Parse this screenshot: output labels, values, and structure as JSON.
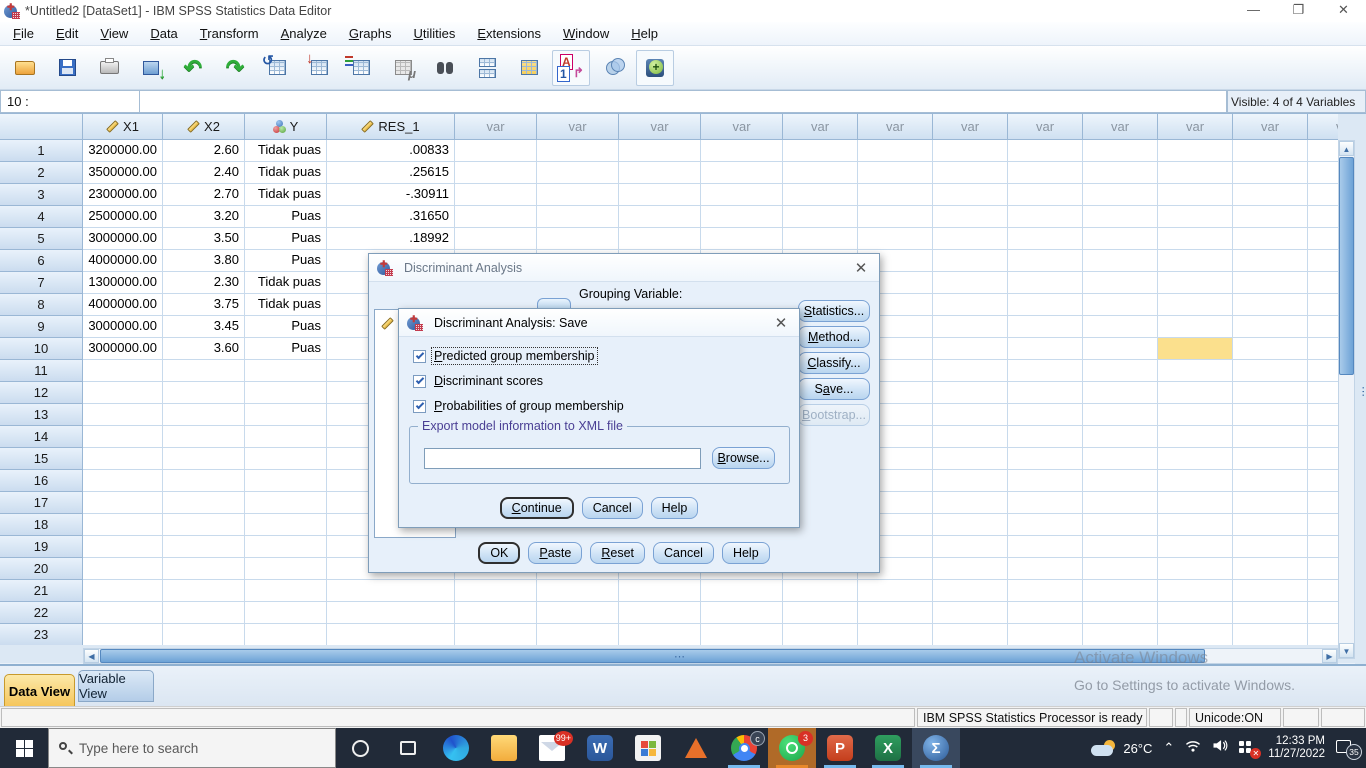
{
  "window": {
    "title": "*Untitled2 [DataSet1] - IBM SPSS Statistics Data Editor"
  },
  "menu": {
    "items": [
      {
        "label": "File",
        "accel": 0
      },
      {
        "label": "Edit",
        "accel": 0
      },
      {
        "label": "View",
        "accel": 0
      },
      {
        "label": "Data",
        "accel": 0
      },
      {
        "label": "Transform",
        "accel": 0
      },
      {
        "label": "Analyze",
        "accel": 0
      },
      {
        "label": "Graphs",
        "accel": 0
      },
      {
        "label": "Utilities",
        "accel": 0
      },
      {
        "label": "Extensions",
        "accel": 0
      },
      {
        "label": "Window",
        "accel": 0
      },
      {
        "label": "Help",
        "accel": 0
      }
    ]
  },
  "toolbar": {
    "icons": [
      "open-data-icon",
      "save-icon",
      "print-icon",
      "recall-dialogs-icon",
      "undo-icon",
      "redo-icon",
      "goto-case-icon",
      "goto-variable-icon",
      "variables-icon",
      "descriptives-icon",
      "find-icon",
      "split-file-icon",
      "select-cases-icon",
      "value-labels-icon",
      "use-variable-sets-icon",
      "extensions-icon"
    ]
  },
  "cellref": {
    "value": "10 :",
    "editor_value": "",
    "visible_indicator": "Visible: 4 of 4 Variables"
  },
  "grid": {
    "columns": [
      {
        "name": "X1",
        "type": "scale"
      },
      {
        "name": "X2",
        "type": "scale"
      },
      {
        "name": "Y",
        "type": "nominal"
      },
      {
        "name": "RES_1",
        "type": "scale"
      }
    ],
    "var_label": "var",
    "rows": [
      {
        "n": "1",
        "values": [
          "3200000.00",
          "2.60",
          "Tidak puas",
          ".00833"
        ]
      },
      {
        "n": "2",
        "values": [
          "3500000.00",
          "2.40",
          "Tidak puas",
          ".25615"
        ]
      },
      {
        "n": "3",
        "values": [
          "2300000.00",
          "2.70",
          "Tidak puas",
          "-.30911"
        ]
      },
      {
        "n": "4",
        "values": [
          "2500000.00",
          "3.20",
          "Puas",
          ".31650"
        ]
      },
      {
        "n": "5",
        "values": [
          "3000000.00",
          "3.50",
          "Puas",
          ".18992"
        ]
      },
      {
        "n": "6",
        "values": [
          "4000000.00",
          "3.80",
          "Puas",
          null
        ]
      },
      {
        "n": "7",
        "values": [
          "1300000.00",
          "2.30",
          "Tidak puas",
          null
        ]
      },
      {
        "n": "8",
        "values": [
          "4000000.00",
          "3.75",
          "Tidak puas",
          null
        ]
      },
      {
        "n": "9",
        "values": [
          "3000000.00",
          "3.45",
          "Puas",
          null
        ]
      },
      {
        "n": "10",
        "values": [
          "3000000.00",
          "3.60",
          "Puas",
          null
        ]
      }
    ],
    "total_rows": 23,
    "highlight_cell": {
      "row": 10,
      "var_col": 9,
      "color": "#fbe08d"
    }
  },
  "dialog_main": {
    "title": "Discriminant Analysis",
    "grouping_label": "Grouping Variable:",
    "side_buttons": [
      {
        "label": "Statistics...",
        "accel": 0
      },
      {
        "label": "Method...",
        "accel": 0
      },
      {
        "label": "Classify...",
        "accel": 0
      },
      {
        "label": "Save...",
        "accel": 1
      },
      {
        "label": "Bootstrap...",
        "accel": 0,
        "disabled": true
      }
    ],
    "bottom_buttons": [
      {
        "label": "OK",
        "accel": -1,
        "default": true
      },
      {
        "label": "Paste",
        "accel": 0
      },
      {
        "label": "Reset",
        "accel": 0
      },
      {
        "label": "Cancel",
        "accel": -1
      },
      {
        "label": "Help",
        "accel": -1
      }
    ]
  },
  "dialog_save": {
    "title": "Discriminant Analysis: Save",
    "checkboxes": [
      {
        "label": "Predicted group membership",
        "accel": 0,
        "checked": true,
        "focused": true
      },
      {
        "label": "Discriminant scores",
        "accel": 0,
        "checked": true
      },
      {
        "label": "Probabilities of group membership",
        "accel": 0,
        "checked": true
      }
    ],
    "group_label": "Export model information to XML file",
    "xml_path_value": "",
    "browse_button": {
      "label": "Browse...",
      "accel": 0
    },
    "bottom_buttons": [
      {
        "label": "Continue",
        "accel": 0,
        "default": true
      },
      {
        "label": "Cancel",
        "accel": -1
      },
      {
        "label": "Help",
        "accel": -1
      }
    ]
  },
  "tabs": {
    "data_view": "Data View",
    "variable_view": "Variable View",
    "active": "Data View"
  },
  "statusbar": {
    "message": "IBM SPSS Statistics Processor is ready",
    "unicode": "Unicode:ON"
  },
  "watermark": {
    "line1": "Activate Windows",
    "line2": "Go to Settings to activate Windows."
  },
  "taskbar": {
    "search_placeholder": "Type here to search",
    "apps": [
      {
        "name": "edge",
        "running": false
      },
      {
        "name": "explorer",
        "running": false
      },
      {
        "name": "mail",
        "badge": "99+",
        "running": false
      },
      {
        "name": "word",
        "running": false
      },
      {
        "name": "store",
        "running": false
      },
      {
        "name": "matlab",
        "running": false
      },
      {
        "name": "chrome",
        "badge": "c",
        "running": true
      },
      {
        "name": "whatsapp",
        "badge": "3",
        "running": true,
        "attention": true
      },
      {
        "name": "powerpoint",
        "running": true
      },
      {
        "name": "excel",
        "running": true
      },
      {
        "name": "spss",
        "running": true,
        "active": true
      }
    ],
    "tray": {
      "temperature": "26°C",
      "time": "12:33 PM",
      "date": "11/27/2022",
      "notification_count": "35"
    }
  }
}
